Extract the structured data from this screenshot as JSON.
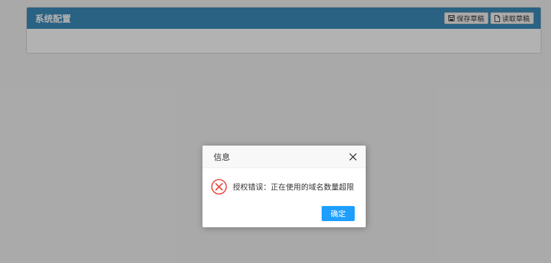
{
  "panel": {
    "title": "系统配置",
    "buttons": [
      {
        "label": "保存草稿",
        "icon": "save-icon"
      },
      {
        "label": "读取草稿",
        "icon": "file-icon"
      }
    ]
  },
  "dialog": {
    "title": "信息",
    "message": "授权错误：正在使用的域名数量超限",
    "confirm_label": "确定",
    "close_icon": "close-icon",
    "status_icon": "error-circle-icon"
  },
  "colors": {
    "header_bg": "#3c8dbc",
    "confirm_bg": "#1e9fff",
    "error_red": "#e8433a"
  }
}
